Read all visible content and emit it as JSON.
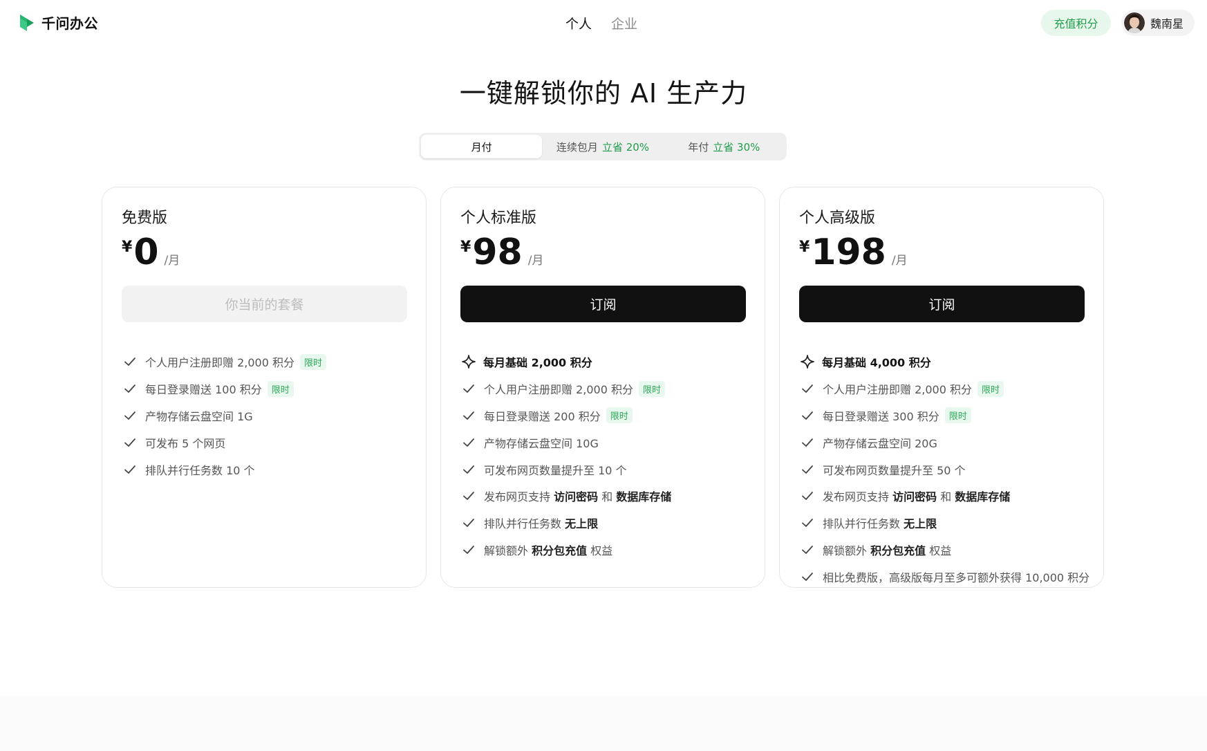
{
  "header": {
    "brand": "千问办公",
    "nav": [
      {
        "label": "个人",
        "active": true
      },
      {
        "label": "企业",
        "active": false
      }
    ],
    "recharge_label": "充值积分",
    "user_name": "魏南星"
  },
  "headline": "一键解锁你的 AI 生产力",
  "billing": {
    "options": [
      {
        "label": "月付",
        "save": "",
        "selected": true
      },
      {
        "label": "连续包月",
        "save": "立省 20%",
        "selected": false
      },
      {
        "label": "年付",
        "save": "立省 30%",
        "selected": false
      }
    ]
  },
  "plans": [
    {
      "name": "免费版",
      "currency": "¥",
      "price": "0",
      "unit": "/月",
      "button": "你当前的套餐",
      "features": [
        {
          "parts": [
            {
              "t": "个人用户注册即赠 2,000 积分"
            }
          ],
          "tag": "限时"
        },
        {
          "parts": [
            {
              "t": "每日登录赠送 100 积分"
            }
          ],
          "tag": "限时"
        },
        {
          "parts": [
            {
              "t": "产物存储云盘空间 1G"
            }
          ],
          "tag": ""
        },
        {
          "parts": [
            {
              "t": "可发布 5 个网页"
            }
          ],
          "tag": ""
        },
        {
          "parts": [
            {
              "t": "排队并行任务数 10 个"
            }
          ],
          "tag": ""
        }
      ]
    },
    {
      "name": "个人标准版",
      "currency": "¥",
      "price": "98",
      "unit": "/月",
      "button": "订阅",
      "highlight": "每月基础 2,000 积分",
      "features": [
        {
          "parts": [
            {
              "t": "个人用户注册即赠 2,000 积分"
            }
          ],
          "tag": "限时"
        },
        {
          "parts": [
            {
              "t": "每日登录赠送 200 积分"
            }
          ],
          "tag": "限时"
        },
        {
          "parts": [
            {
              "t": "产物存储云盘空间 10G"
            }
          ],
          "tag": ""
        },
        {
          "parts": [
            {
              "t": "可发布网页数量提升至 10 个"
            }
          ],
          "tag": ""
        },
        {
          "parts": [
            {
              "t": "发布网页支持 "
            },
            {
              "t": "访问密码",
              "b": true
            },
            {
              "t": " 和 "
            },
            {
              "t": "数据库存储",
              "b": true
            }
          ],
          "tag": ""
        },
        {
          "parts": [
            {
              "t": "排队并行任务数 "
            },
            {
              "t": "无上限",
              "b": true
            }
          ],
          "tag": ""
        },
        {
          "parts": [
            {
              "t": "解锁额外 "
            },
            {
              "t": "积分包充值",
              "b": true
            },
            {
              "t": " 权益"
            }
          ],
          "tag": ""
        }
      ]
    },
    {
      "name": "个人高级版",
      "currency": "¥",
      "price": "198",
      "unit": "/月",
      "button": "订阅",
      "highlight": "每月基础 4,000 积分",
      "features": [
        {
          "parts": [
            {
              "t": "个人用户注册即赠 2,000 积分"
            }
          ],
          "tag": "限时"
        },
        {
          "parts": [
            {
              "t": "每日登录赠送 300 积分"
            }
          ],
          "tag": "限时"
        },
        {
          "parts": [
            {
              "t": "产物存储云盘空间 20G"
            }
          ],
          "tag": ""
        },
        {
          "parts": [
            {
              "t": "可发布网页数量提升至 50 个"
            }
          ],
          "tag": ""
        },
        {
          "parts": [
            {
              "t": "发布网页支持 "
            },
            {
              "t": "访问密码",
              "b": true
            },
            {
              "t": " 和 "
            },
            {
              "t": "数据库存储",
              "b": true
            }
          ],
          "tag": ""
        },
        {
          "parts": [
            {
              "t": "排队并行任务数 "
            },
            {
              "t": "无上限",
              "b": true
            }
          ],
          "tag": ""
        },
        {
          "parts": [
            {
              "t": "解锁额外 "
            },
            {
              "t": "积分包充值",
              "b": true
            },
            {
              "t": " 权益"
            }
          ],
          "tag": ""
        },
        {
          "parts": [
            {
              "t": "相比免费版，高级版每月至多可额外获得 10,000 积分"
            }
          ],
          "tag": ""
        }
      ]
    }
  ]
}
